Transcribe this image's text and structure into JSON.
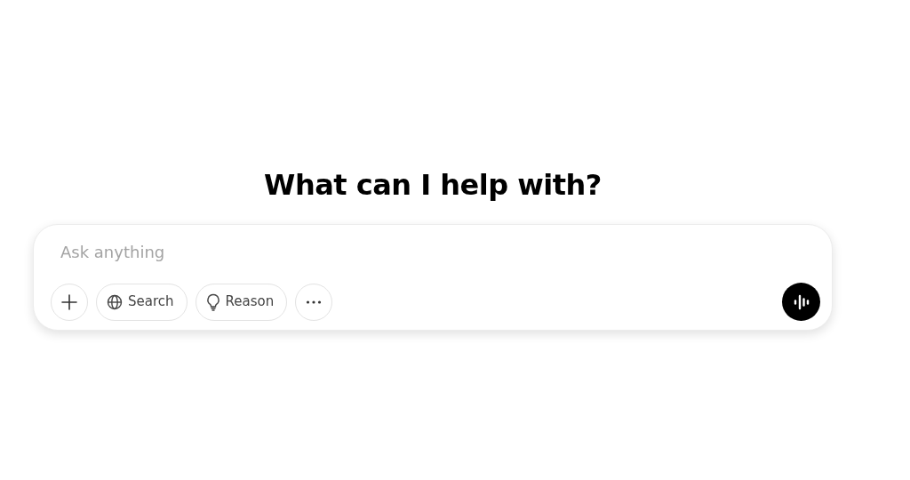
{
  "heading": "What can I help with?",
  "composer": {
    "placeholder": "Ask anything",
    "tools": [
      {
        "kind": "add"
      },
      {
        "kind": "search",
        "label": "Search"
      },
      {
        "kind": "reason",
        "label": "Reason"
      },
      {
        "kind": "more"
      }
    ]
  }
}
